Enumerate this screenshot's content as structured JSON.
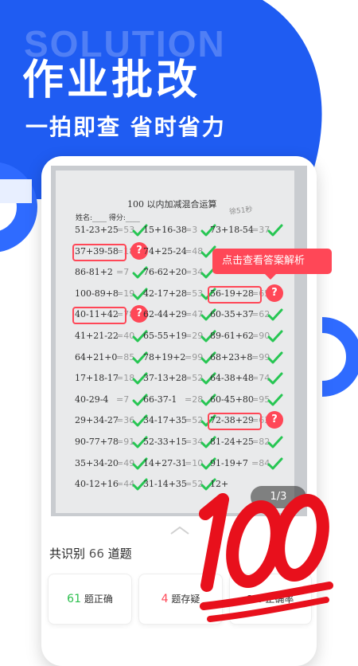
{
  "header": {
    "watermark": "SOLUTION",
    "title": "作业批改",
    "subtitle": "一拍即查 省时省力"
  },
  "colors": {
    "primary": "#1f5cf2",
    "primary_light": "#3c79ff",
    "error": "#ff4757",
    "correct": "#27c653"
  },
  "worksheet": {
    "title": "100 以内加减混合运算",
    "meta": "姓名:____ 得分:____",
    "handwriting": "徐51秒",
    "rows": [
      {
        "items": [
          {
            "q": "51-23+25",
            "a": "=53",
            "s": "ok"
          },
          {
            "q": "15+16-38",
            "a": "=3",
            "s": "ok"
          },
          {
            "q": "73+18-54",
            "a": "=37",
            "s": "ok"
          }
        ]
      },
      {
        "items": [
          {
            "q": "37+39-58",
            "a": "=18",
            "s": "flag"
          },
          {
            "q": "74+25-24",
            "a": "=48",
            "s": "ok"
          },
          {
            "q": "",
            "a": "",
            "s": "none"
          }
        ]
      },
      {
        "items": [
          {
            "q": "86-81+2",
            "a": "=7",
            "s": "ok"
          },
          {
            "q": "76-62+20",
            "a": "=34",
            "s": "ok"
          },
          {
            "q": "",
            "a": "",
            "s": "none"
          }
        ]
      },
      {
        "items": [
          {
            "q": "100-89+8",
            "a": "=19",
            "s": "ok"
          },
          {
            "q": "42-17+28",
            "a": "=53",
            "s": "ok"
          },
          {
            "q": "56-19+28",
            "a": "=65",
            "s": "flag"
          }
        ]
      },
      {
        "items": [
          {
            "q": "40-11+42",
            "a": "=78",
            "s": "flag"
          },
          {
            "q": "62-44+29",
            "a": "=47",
            "s": "ok"
          },
          {
            "q": "60-35+37",
            "a": "=62",
            "s": "ok"
          }
        ]
      },
      {
        "items": [
          {
            "q": "41+21-22",
            "a": "=40",
            "s": "ok"
          },
          {
            "q": "65-55+19",
            "a": "=29",
            "s": "ok"
          },
          {
            "q": "89-61+62",
            "a": "=90",
            "s": "ok"
          }
        ]
      },
      {
        "items": [
          {
            "q": "64+21+0",
            "a": "=85",
            "s": "ok"
          },
          {
            "q": "78+19+2",
            "a": "=99",
            "s": "ok"
          },
          {
            "q": "68+23+8",
            "a": "=99",
            "s": "ok"
          }
        ]
      },
      {
        "items": [
          {
            "q": "17+18-17",
            "a": "=18",
            "s": "ok"
          },
          {
            "q": "37-13+28",
            "a": "=52",
            "s": "ok"
          },
          {
            "q": "64-38+48",
            "a": "=74",
            "s": "ok"
          }
        ]
      },
      {
        "items": [
          {
            "q": "40-29-4",
            "a": "=7",
            "s": "ok"
          },
          {
            "q": "66-37-1",
            "a": "=28",
            "s": "ok"
          },
          {
            "q": "60-45+80",
            "a": "=95",
            "s": "ok"
          }
        ]
      },
      {
        "items": [
          {
            "q": "29+34-27",
            "a": "=36",
            "s": "ok"
          },
          {
            "q": "34-17+35",
            "a": "=52",
            "s": "ok"
          },
          {
            "q": "72-38+29",
            "a": "=63",
            "s": "flag"
          }
        ]
      },
      {
        "items": [
          {
            "q": "90-77+78",
            "a": "=91",
            "s": "ok"
          },
          {
            "q": "52-33+15",
            "a": "=34",
            "s": "ok"
          },
          {
            "q": "81-24+25",
            "a": "=82",
            "s": "ok"
          }
        ]
      },
      {
        "items": [
          {
            "q": "35+34-20",
            "a": "=49",
            "s": "ok"
          },
          {
            "q": "14+27-31",
            "a": "=10",
            "s": "ok"
          },
          {
            "q": "91-19+7",
            "a": "=84",
            "s": "ok"
          }
        ]
      },
      {
        "items": [
          {
            "q": "40-12+16",
            "a": "=44",
            "s": "ok"
          },
          {
            "q": "31-14+35",
            "a": "=52",
            "s": "ok"
          },
          {
            "q": "12+",
            "a": "",
            "s": "none"
          }
        ]
      }
    ]
  },
  "tooltip": "点击查看答案解析",
  "pager": "1/3",
  "summary": {
    "prefix": "共识别",
    "count": "66",
    "suffix": "道题"
  },
  "stats": [
    {
      "value": "61",
      "label": "题正确"
    },
    {
      "value": "4",
      "label": "题存疑"
    },
    {
      "value": "2%",
      "label": "正确率"
    }
  ],
  "stamp": "100"
}
